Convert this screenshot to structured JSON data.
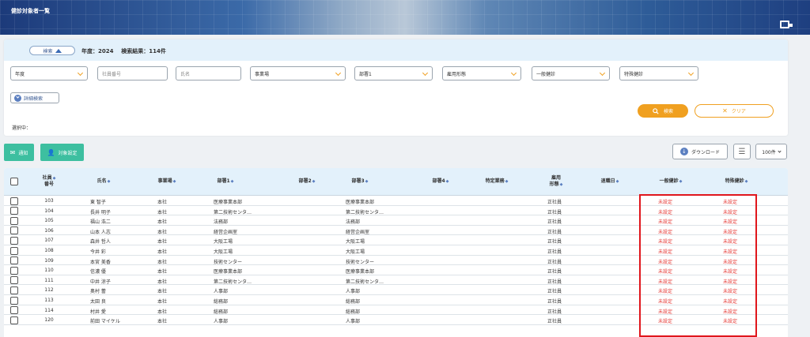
{
  "header": {
    "title": "健診対象者一覧"
  },
  "search": {
    "toggle_label": "検索",
    "year_label": "年度：2024",
    "result_label": "検索結果：114件",
    "filters": {
      "year": "年度",
      "employee_no": "社員番号",
      "name": "氏名",
      "office": "事業場",
      "dept1": "部署1",
      "employment": "雇用形態",
      "general_checkup": "一般健診",
      "special_checkup": "特殊健診"
    },
    "detail_label": "詳細検索",
    "search_button": "検索",
    "clear_button": "クリア",
    "selected_label": "選択中："
  },
  "actions": {
    "notify": "通知",
    "target_setting": "対象設定",
    "download": "ダウンロード",
    "per_page": "100件"
  },
  "table": {
    "headers": {
      "emp_no_1": "社員",
      "emp_no_2": "番号",
      "name": "氏名",
      "office": "事業場",
      "dept1": "部署1",
      "dept2": "部署2",
      "dept3": "部署3",
      "dept4": "部署4",
      "special_work": "特定業務",
      "employment_1": "雇用",
      "employment_2": "形態",
      "retire_date": "退職日",
      "general": "一般健診",
      "special": "特殊健診"
    },
    "rows": [
      {
        "no": "103",
        "name": "東 智子",
        "office": "本社",
        "dept1": "医療事業本部",
        "dept3": "医療事業本部",
        "emp": "正社員",
        "general": "未設定",
        "special": "未設定"
      },
      {
        "no": "104",
        "name": "長井 明子",
        "office": "本社",
        "dept1": "第二技術センタ…",
        "dept3": "第二技術センタ…",
        "emp": "正社員",
        "general": "未設定",
        "special": "未設定"
      },
      {
        "no": "105",
        "name": "福山 浩二",
        "office": "本社",
        "dept1": "法務部",
        "dept3": "法務部",
        "emp": "正社員",
        "general": "未設定",
        "special": "未設定"
      },
      {
        "no": "106",
        "name": "山本 人志",
        "office": "本社",
        "dept1": "経営企画室",
        "dept3": "経営企画室",
        "emp": "正社員",
        "general": "未設定",
        "special": "未設定"
      },
      {
        "no": "107",
        "name": "森井 哲人",
        "office": "本社",
        "dept1": "大阪工場",
        "dept3": "大阪工場",
        "emp": "正社員",
        "general": "未設定",
        "special": "未設定"
      },
      {
        "no": "108",
        "name": "今井 彩",
        "office": "本社",
        "dept1": "大阪工場",
        "dept3": "大阪工場",
        "emp": "正社員",
        "general": "未設定",
        "special": "未設定"
      },
      {
        "no": "109",
        "name": "本宮 美香",
        "office": "本社",
        "dept1": "技術センター",
        "dept3": "技術センター",
        "emp": "正社員",
        "general": "未設定",
        "special": "未設定"
      },
      {
        "no": "110",
        "name": "信濃 優",
        "office": "本社",
        "dept1": "医療事業本部",
        "dept3": "医療事業本部",
        "emp": "正社員",
        "general": "未設定",
        "special": "未設定"
      },
      {
        "no": "111",
        "name": "中井 涼子",
        "office": "本社",
        "dept1": "第二技術センタ…",
        "dept3": "第二技術センタ…",
        "emp": "正社員",
        "general": "未設定",
        "special": "未設定"
      },
      {
        "no": "112",
        "name": "奥村 蕾",
        "office": "本社",
        "dept1": "人事部",
        "dept3": "人事部",
        "emp": "正社員",
        "general": "未設定",
        "special": "未設定"
      },
      {
        "no": "113",
        "name": "太田 良",
        "office": "本社",
        "dept1": "総務部",
        "dept3": "総務部",
        "emp": "正社員",
        "general": "未設定",
        "special": "未設定"
      },
      {
        "no": "114",
        "name": "村井 愛",
        "office": "本社",
        "dept1": "総務部",
        "dept3": "総務部",
        "emp": "正社員",
        "general": "未設定",
        "special": "未設定"
      },
      {
        "no": "120",
        "name": "前田 マイケル",
        "office": "本社",
        "dept1": "人事部",
        "dept3": "人事部",
        "emp": "正社員",
        "general": "未設定",
        "special": "未設定"
      }
    ]
  }
}
